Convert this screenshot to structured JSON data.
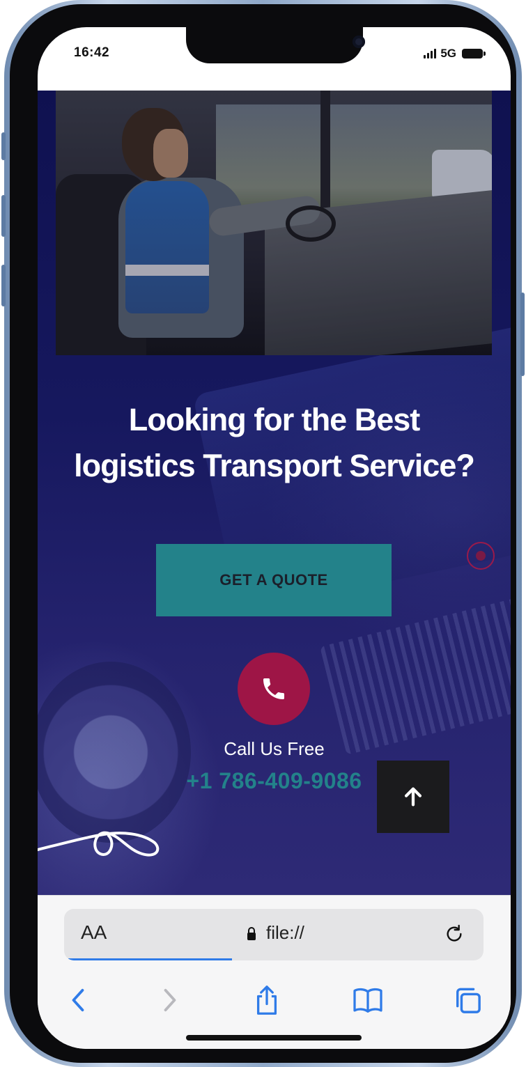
{
  "status_bar": {
    "time": "16:42",
    "network": "5G"
  },
  "hero": {
    "headline_line1": "Looking for the Best",
    "headline_line2": "logistics Transport Service?",
    "quote_button": "GET A QUOTE",
    "call_label": "Call Us Free",
    "phone_number": "+1 786-409-9086"
  },
  "browser": {
    "text_size_label": "AA",
    "url": "file://"
  },
  "colors": {
    "accent_teal": "#23828a",
    "phone_red": "#9e1546",
    "hero_navy": "#16185e"
  }
}
